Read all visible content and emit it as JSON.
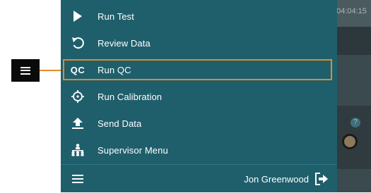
{
  "background": {
    "time_fragment": "04:04:15"
  },
  "menu": {
    "items": [
      {
        "label": "Run Test",
        "icon": "play-icon"
      },
      {
        "label": "Review Data",
        "icon": "undo-arrow-icon"
      },
      {
        "label": "Run QC",
        "icon": "qc-icon",
        "icon_text": "QC"
      },
      {
        "label": "Run Calibration",
        "icon": "crosshair-icon"
      },
      {
        "label": "Send Data",
        "icon": "upload-icon"
      },
      {
        "label": "Supervisor Menu",
        "icon": "hierarchy-icon"
      }
    ],
    "highlighted_index": 2
  },
  "footer": {
    "user_name": "Jon Greenwood",
    "menu_icon": "hamburger-icon",
    "logout_icon": "logout-icon"
  },
  "callout": {
    "icon": "hamburger-icon"
  },
  "colors": {
    "menu_bg": "#1f5f6c",
    "highlight": "#e08a2a"
  }
}
